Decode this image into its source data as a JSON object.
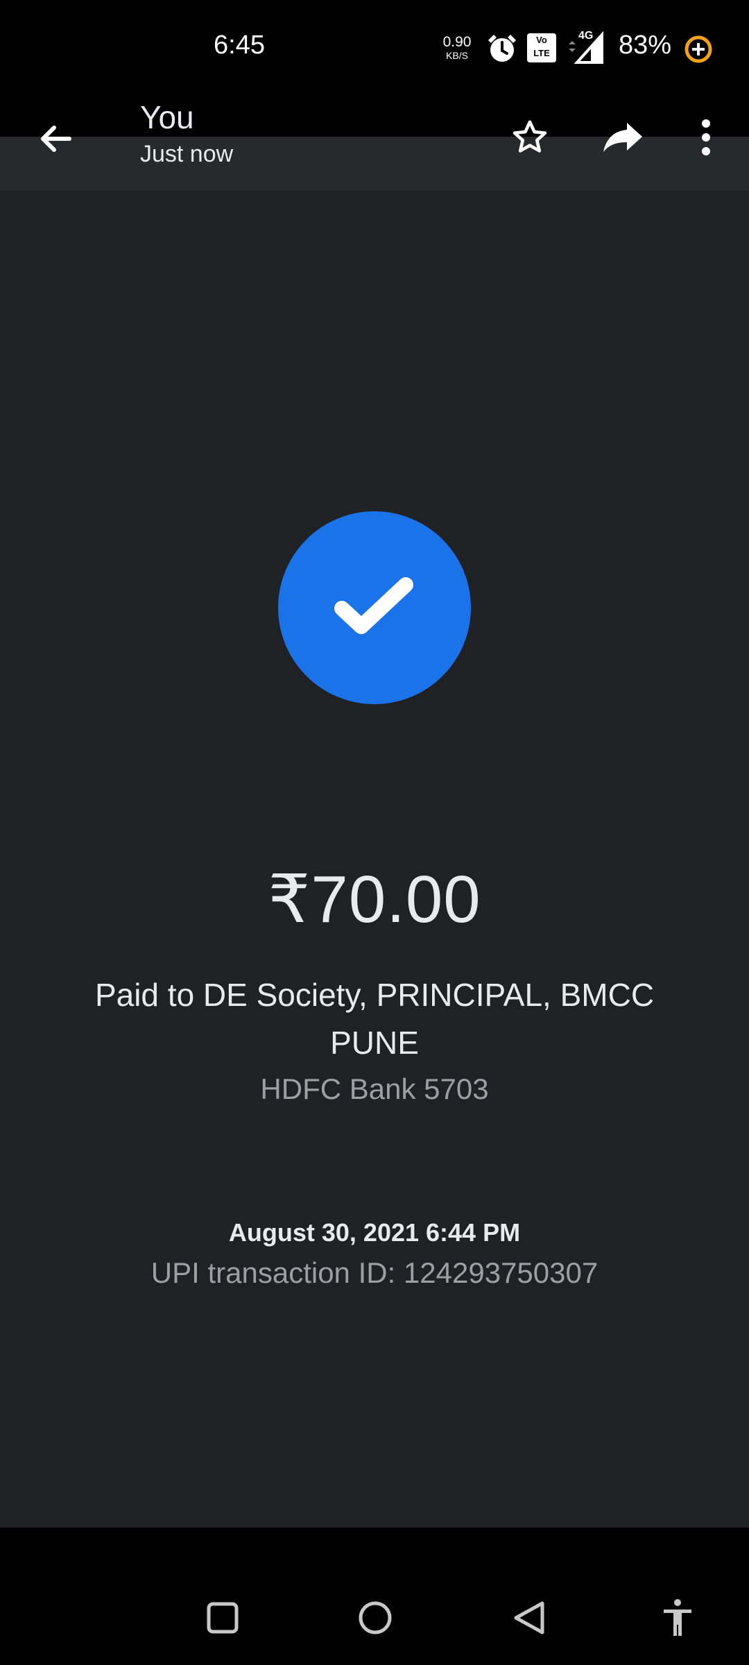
{
  "status_bar": {
    "time": "6:45",
    "network_speed_value": "0.90",
    "network_speed_unit": "KB/S",
    "volte_label": "Vo LTE",
    "network_type": "4G",
    "battery_percent": "83%",
    "icons": [
      "alarm-icon",
      "volte-icon",
      "signal-icon",
      "battery-icon"
    ]
  },
  "header": {
    "title": "You",
    "subtitle": "Just now",
    "icons": [
      "back-arrow-icon",
      "star-icon",
      "share-icon",
      "more-vert-icon"
    ]
  },
  "payment": {
    "status_icon": "check-icon",
    "amount": "₹70.00",
    "payee": "Paid to DE Society, PRINCIPAL, BMCC PUNE",
    "bank": "HDFC Bank 5703",
    "datetime": "August 30, 2021 6:44 PM",
    "transaction_id": "UPI transaction ID: 124293750307"
  },
  "nav_bar": {
    "icons": [
      "recents-icon",
      "home-icon",
      "back-icon",
      "accessibility-icon"
    ]
  },
  "colors": {
    "accent": "#1a73e8",
    "background": "#202124",
    "secondary_text": "#9aa0a6",
    "battery_ring": "#f4a21b"
  }
}
